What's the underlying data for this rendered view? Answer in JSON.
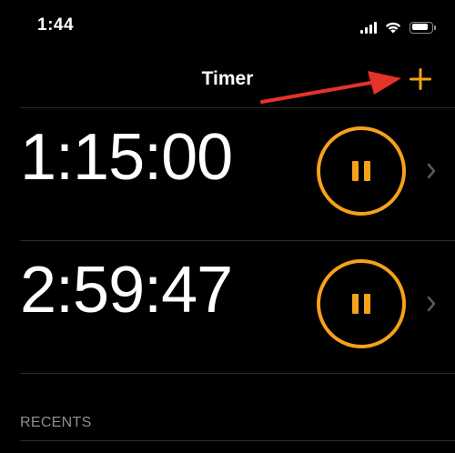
{
  "status_bar": {
    "time": "1:44",
    "signal_icon": "cellular-signal-icon",
    "wifi_icon": "wifi-icon",
    "battery_icon": "battery-icon",
    "battery_level": 0.85
  },
  "nav": {
    "title": "Timer",
    "add_icon": "plus-icon"
  },
  "annotation": {
    "arrow_icon": "red-arrow-icon",
    "arrow_color": "#e5332a"
  },
  "timers": [
    {
      "value": "1:15:00",
      "state": "running",
      "control_icon": "pause-icon",
      "detail_icon": "chevron-right-icon"
    },
    {
      "value": "2:59:47",
      "state": "running",
      "control_icon": "pause-icon",
      "detail_icon": "chevron-right-icon"
    }
  ],
  "recents": {
    "header": "RECENTS"
  },
  "colors": {
    "background": "#000000",
    "accent": "#f5a11c",
    "text": "#ffffff",
    "secondary_text": "#8e8e93",
    "separator": "#2b2b2e",
    "chevron": "#5a5a5e"
  }
}
